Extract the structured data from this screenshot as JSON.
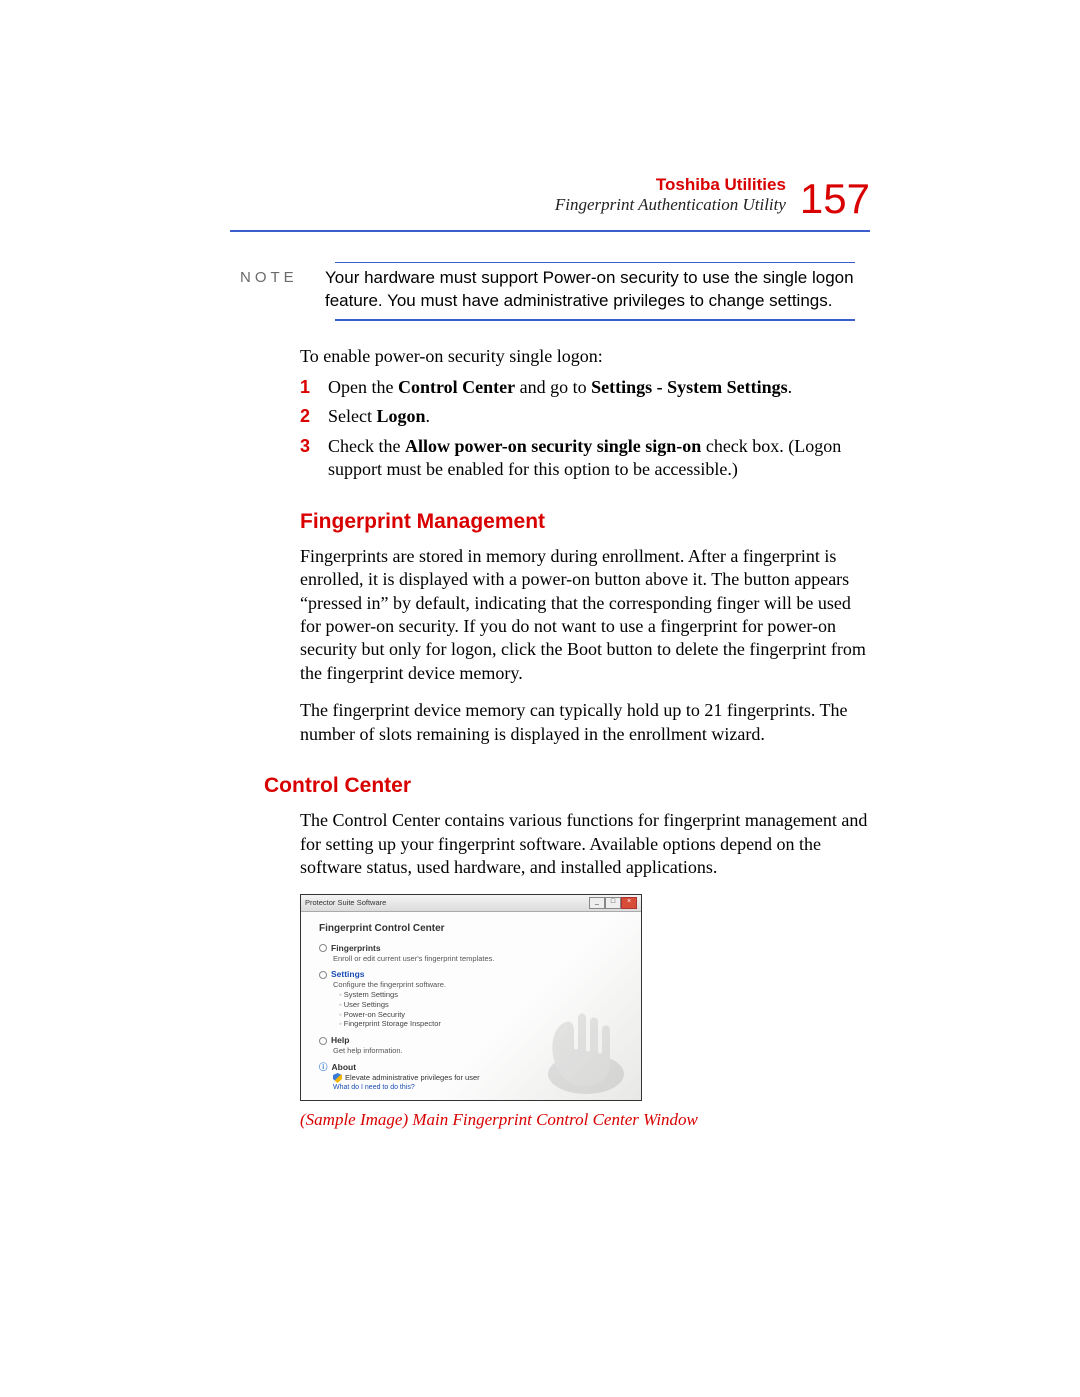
{
  "header": {
    "chapter": "Toshiba Utilities",
    "section": "Fingerprint Authentication Utility",
    "page_number": "157"
  },
  "note": {
    "label": "NOTE",
    "text": "Your hardware must support Power-on security to use the single logon feature. You must have administrative privileges to change settings."
  },
  "intro": "To enable power-on security single logon:",
  "steps": [
    {
      "num": "1",
      "prefix": "Open the ",
      "bold1": "Control Center",
      "mid": " and go to ",
      "bold2": "Settings - System Settings",
      "suffix": "."
    },
    {
      "num": "2",
      "prefix": "Select ",
      "bold1": "Logon",
      "suffix": "."
    },
    {
      "num": "3",
      "prefix": "Check the ",
      "bold1": "Allow power-on security single sign-on",
      "mid": " check box. (Logon support must be enabled for this option to be accessible.)"
    }
  ],
  "section1": {
    "heading": "Fingerprint Management",
    "p1": "Fingerprints are stored in memory during enrollment. After a fingerprint is enrolled, it is displayed with a power-on button above it. The button appears “pressed in” by default, indicating that the corresponding finger will be used for power-on security. If you do not want to use a fingerprint for power-on security but only for logon, click the Boot button to delete the fingerprint from the fingerprint device memory.",
    "p2": "The fingerprint device memory can typically hold up to 21 fingerprints. The number of slots remaining is displayed in the enrollment wizard."
  },
  "section2": {
    "heading": "Control Center",
    "p1": "The Control Center contains various functions for fingerprint management and for setting up your fingerprint software. Available options depend on the software status, used hardware, and installed applications."
  },
  "screenshot": {
    "window_title": "Protector Suite Software",
    "heading": "Fingerprint Control Center",
    "groups": {
      "fingerprints": {
        "title": "Fingerprints",
        "desc": "Enroll or edit current user's fingerprint templates."
      },
      "settings": {
        "title": "Settings",
        "desc": "Configure the fingerprint software.",
        "items": [
          "System Settings",
          "User Settings",
          "Power-on Security",
          "Fingerprint Storage Inspector"
        ]
      },
      "help": {
        "title": "Help",
        "desc": "Get help information."
      },
      "about": {
        "title": "About",
        "elevate": "Elevate administrative privileges for user",
        "what": "What do I need to do this?"
      }
    }
  },
  "caption": "(Sample Image) Main Fingerprint Control Center Window"
}
